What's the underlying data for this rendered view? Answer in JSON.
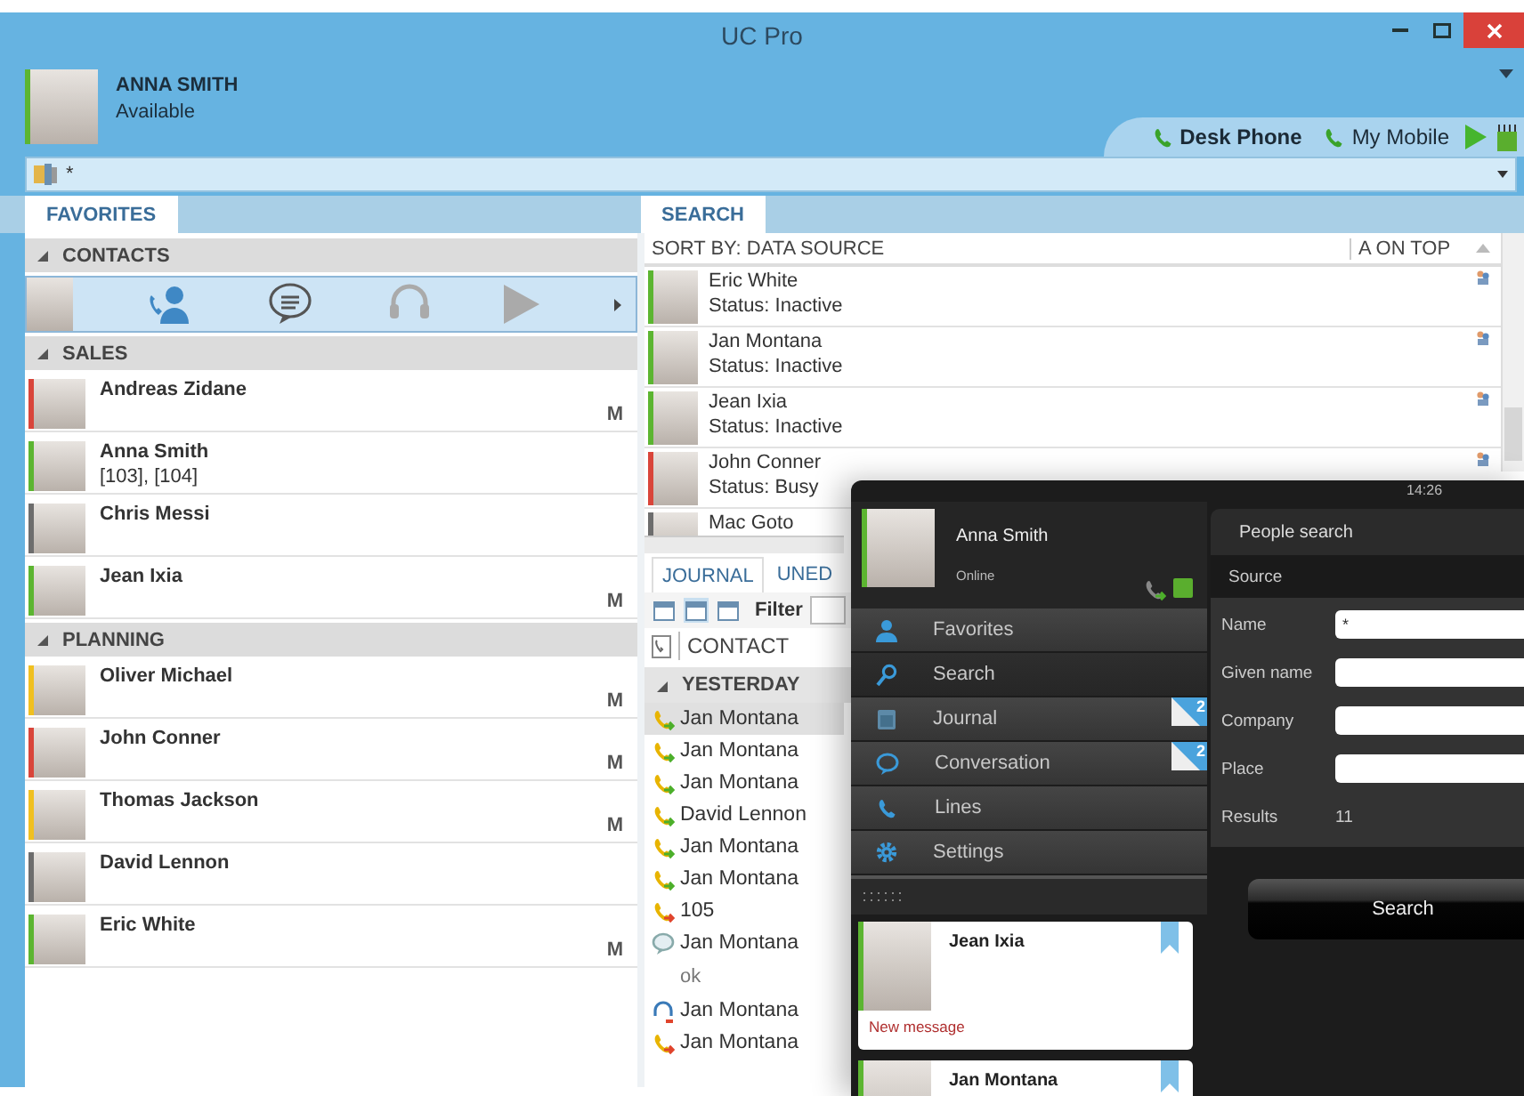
{
  "window": {
    "title": "UC Pro"
  },
  "user": {
    "name": "ANNA SMITH",
    "status": "Available",
    "color": "#5cb531"
  },
  "devices": [
    {
      "label": "Desk Phone",
      "selected": true
    },
    {
      "label": "My Mobile",
      "selected": false
    }
  ],
  "search_field": {
    "value": "*"
  },
  "left_tabs": [
    {
      "label": "FAVORITES",
      "selected": true
    }
  ],
  "right_tabs": [
    {
      "label": "SEARCH",
      "selected": true
    }
  ],
  "contacts_group": {
    "title": "CONTACTS",
    "expanded": true
  },
  "groups": [
    {
      "title": "SALES",
      "expanded": true,
      "contacts": [
        {
          "name": "Andreas Zidane",
          "color": "#d9453a",
          "badge": "M"
        },
        {
          "name": "Anna Smith",
          "detail": "[103], [104]",
          "color": "#5cb531"
        },
        {
          "name": "Chris Messi",
          "color": "#6d6d6d"
        },
        {
          "name": "Jean Ixia",
          "color": "#5cb531",
          "badge": "M"
        }
      ]
    },
    {
      "title": "PLANNING",
      "expanded": true,
      "contacts": [
        {
          "name": "Oliver Michael",
          "color": "#f0c020",
          "badge": "M"
        },
        {
          "name": "John Conner",
          "color": "#d9453a",
          "badge": "M"
        },
        {
          "name": "Thomas Jackson",
          "color": "#f0c020",
          "badge": "M"
        },
        {
          "name": "David Lennon",
          "color": "#6d6d6d"
        },
        {
          "name": "Eric White",
          "color": "#5cb531",
          "badge": "M"
        }
      ]
    }
  ],
  "search_results": {
    "sort_label": "SORT BY: DATA SOURCE",
    "order_label": "A ON TOP",
    "rows": [
      {
        "name": "Eric White",
        "status": "Status: Inactive",
        "color": "#5cb531"
      },
      {
        "name": "Jan Montana",
        "status": "Status: Inactive",
        "color": "#5cb531"
      },
      {
        "name": "Jean Ixia",
        "status": "Status: Inactive",
        "color": "#5cb531"
      },
      {
        "name": "John Conner",
        "status": "Status: Busy",
        "color": "#d9453a"
      },
      {
        "name": "Mac Goto",
        "color": "#6d6d6d"
      }
    ]
  },
  "journal": {
    "tabs": [
      {
        "label": "JOURNAL",
        "selected": true
      },
      {
        "label": "UNED",
        "selected": false
      }
    ],
    "views": [
      {
        "selected": false
      },
      {
        "selected": true
      },
      {
        "selected": false
      }
    ],
    "filter_label": "Filter",
    "column": "CONTACT",
    "group": {
      "title": "YESTERDAY",
      "expanded": true
    },
    "rows": [
      {
        "kind": "call-in",
        "name": "Jan Montana",
        "selected": true
      },
      {
        "kind": "call-in",
        "name": "Jan Montana",
        "selected": false
      },
      {
        "kind": "call-in",
        "name": "Jan Montana",
        "selected": false
      },
      {
        "kind": "call-in",
        "name": "David Lennon",
        "selected": false
      },
      {
        "kind": "call-in",
        "name": "Jan Montana",
        "selected": false
      },
      {
        "kind": "call-in",
        "name": "Jan Montana",
        "selected": false
      },
      {
        "kind": "call-out",
        "name": "105",
        "selected": false
      },
      {
        "kind": "chat",
        "name": "Jan Montana",
        "note": "ok",
        "selected": false
      },
      {
        "kind": "headset",
        "name": "Jan Montana",
        "selected": false
      },
      {
        "kind": "call-out",
        "name": "Jan Montana",
        "selected": false
      }
    ]
  },
  "tablet": {
    "time": "14:26",
    "user": {
      "name": "Anna Smith",
      "status": "Online",
      "color": "#5cb531"
    },
    "menu": [
      {
        "kind": "person",
        "label": "Favorites",
        "selected": false
      },
      {
        "kind": "search",
        "label": "Search",
        "selected": true
      },
      {
        "kind": "calendar",
        "label": "Journal",
        "badge": "2",
        "selected": false
      },
      {
        "kind": "chat",
        "label": "Conversation",
        "badge": "2",
        "selected": false
      },
      {
        "kind": "phone",
        "label": "Lines",
        "selected": false
      },
      {
        "kind": "gear",
        "label": "Settings",
        "selected": false
      }
    ],
    "cards": [
      {
        "name": "Jean Ixia",
        "message": "New message",
        "color": "#5cb531"
      },
      {
        "name": "Jan Montana",
        "color": "#5cb531"
      }
    ],
    "people_search": {
      "title": "People search",
      "source_label": "Source",
      "fields": [
        {
          "label": "Name",
          "value": "*"
        },
        {
          "label": "Given name"
        },
        {
          "label": "Company"
        },
        {
          "label": "Place"
        }
      ],
      "results_label": "Results",
      "results": "11",
      "button": "Search"
    }
  }
}
